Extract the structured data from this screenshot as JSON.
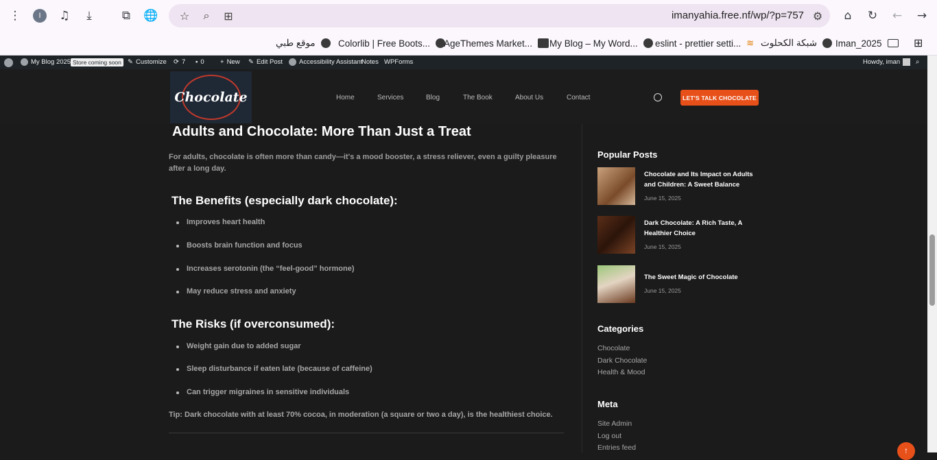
{
  "browser": {
    "profile_initial": "I",
    "url": "imanyahia.free.nf/wp/?p=757",
    "bookmarks": [
      {
        "label": "موقع طبي",
        "icon": "globe-icon"
      },
      {
        "label": "Colorlib | Free Boots...",
        "icon": "globe-icon"
      },
      {
        "label": "AgeThemes Market...",
        "icon": "globe-icon"
      },
      {
        "label": "My Blog – My Word...",
        "icon": "site-icon"
      },
      {
        "label": "eslint - prettier setti...",
        "icon": "globe-icon"
      },
      {
        "label": "شبكة الكحلوت",
        "icon": "stack-icon"
      },
      {
        "label": "Iman_2025",
        "icon": "globe-icon"
      }
    ]
  },
  "adminbar": {
    "site": "My Blog 2025",
    "badge": "Store coming soon",
    "customize": "Customize",
    "updates": "7",
    "comments": "0",
    "new": "New",
    "edit": "Edit Post",
    "accessibility": "Accessibility Assistant",
    "notes": "Notes",
    "wpforms": "WPForms",
    "howdy": "Howdy, iman"
  },
  "header": {
    "logo_text": "Chocolate",
    "nav": [
      "Home",
      "Services",
      "Blog",
      "The Book",
      "About Us",
      "Contact"
    ],
    "cta": "LET'S TALK CHOCOLATE"
  },
  "article": {
    "heading": "Adults and Chocolate: More Than Just a Treat",
    "intro": "For adults, chocolate is often more than candy—it's a mood booster, a stress reliever, even a guilty pleasure after a long day.",
    "benefits_heading": "The Benefits (especially dark chocolate):",
    "benefits": [
      "Improves heart health",
      "Boosts brain function and focus",
      "Increases serotonin (the “feel-good” hormone)",
      "May reduce stress and anxiety"
    ],
    "risks_heading": "The Risks (if overconsumed):",
    "risks": [
      "Weight gain due to added sugar",
      "Sleep disturbance if eaten late (because of caffeine)",
      "Can trigger migraines in sensitive individuals"
    ],
    "tip": "Tip: Dark chocolate with at least 70% cocoa, in moderation (a square or two a day), is the healthiest choice."
  },
  "sidebar": {
    "popular_heading": "Popular Posts",
    "posts": [
      {
        "title": "Chocolate and Its Impact on Adults and Children: A Sweet Balance",
        "date": "June 15, 2025"
      },
      {
        "title": "Dark Chocolate: A Rich Taste, A Healthier Choice",
        "date": "June 15, 2025"
      },
      {
        "title": "The Sweet Magic of Chocolate",
        "date": "June 15, 2025"
      }
    ],
    "categories_heading": "Categories",
    "categories": [
      "Chocolate",
      "Dark Chocolate",
      "Health & Mood"
    ],
    "meta_heading": "Meta",
    "meta": [
      "Site Admin",
      "Log out",
      "Entries feed"
    ]
  },
  "colors": {
    "accent": "#e8501a",
    "background": "#1b1b1b",
    "adminbar": "#1d2327"
  }
}
